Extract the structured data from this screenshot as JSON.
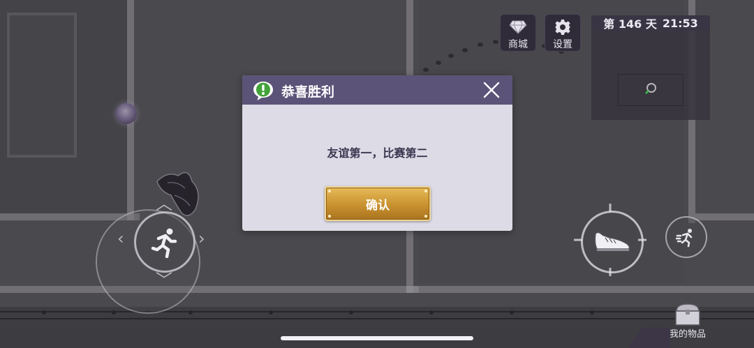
{
  "hud": {
    "shop_label": "商城",
    "settings_label": "设置",
    "day_prefix": "第",
    "day_number": "146",
    "day_suffix": "天",
    "time": "21:53"
  },
  "dialog": {
    "title": "恭喜胜利",
    "message": "友谊第一，比赛第二",
    "confirm_label": "确认"
  },
  "inventory": {
    "label": "我的物品"
  },
  "colors": {
    "dialog_header": "#5c5378",
    "dialog_body": "#dcdbe6",
    "confirm_gold": "#c9912f"
  },
  "icons": [
    "diamond-icon",
    "gear-icon",
    "speech-exclamation-icon",
    "close-icon",
    "running-man-icon",
    "shoe-icon",
    "sprint-icon",
    "chest-icon",
    "map-marker-icon"
  ]
}
